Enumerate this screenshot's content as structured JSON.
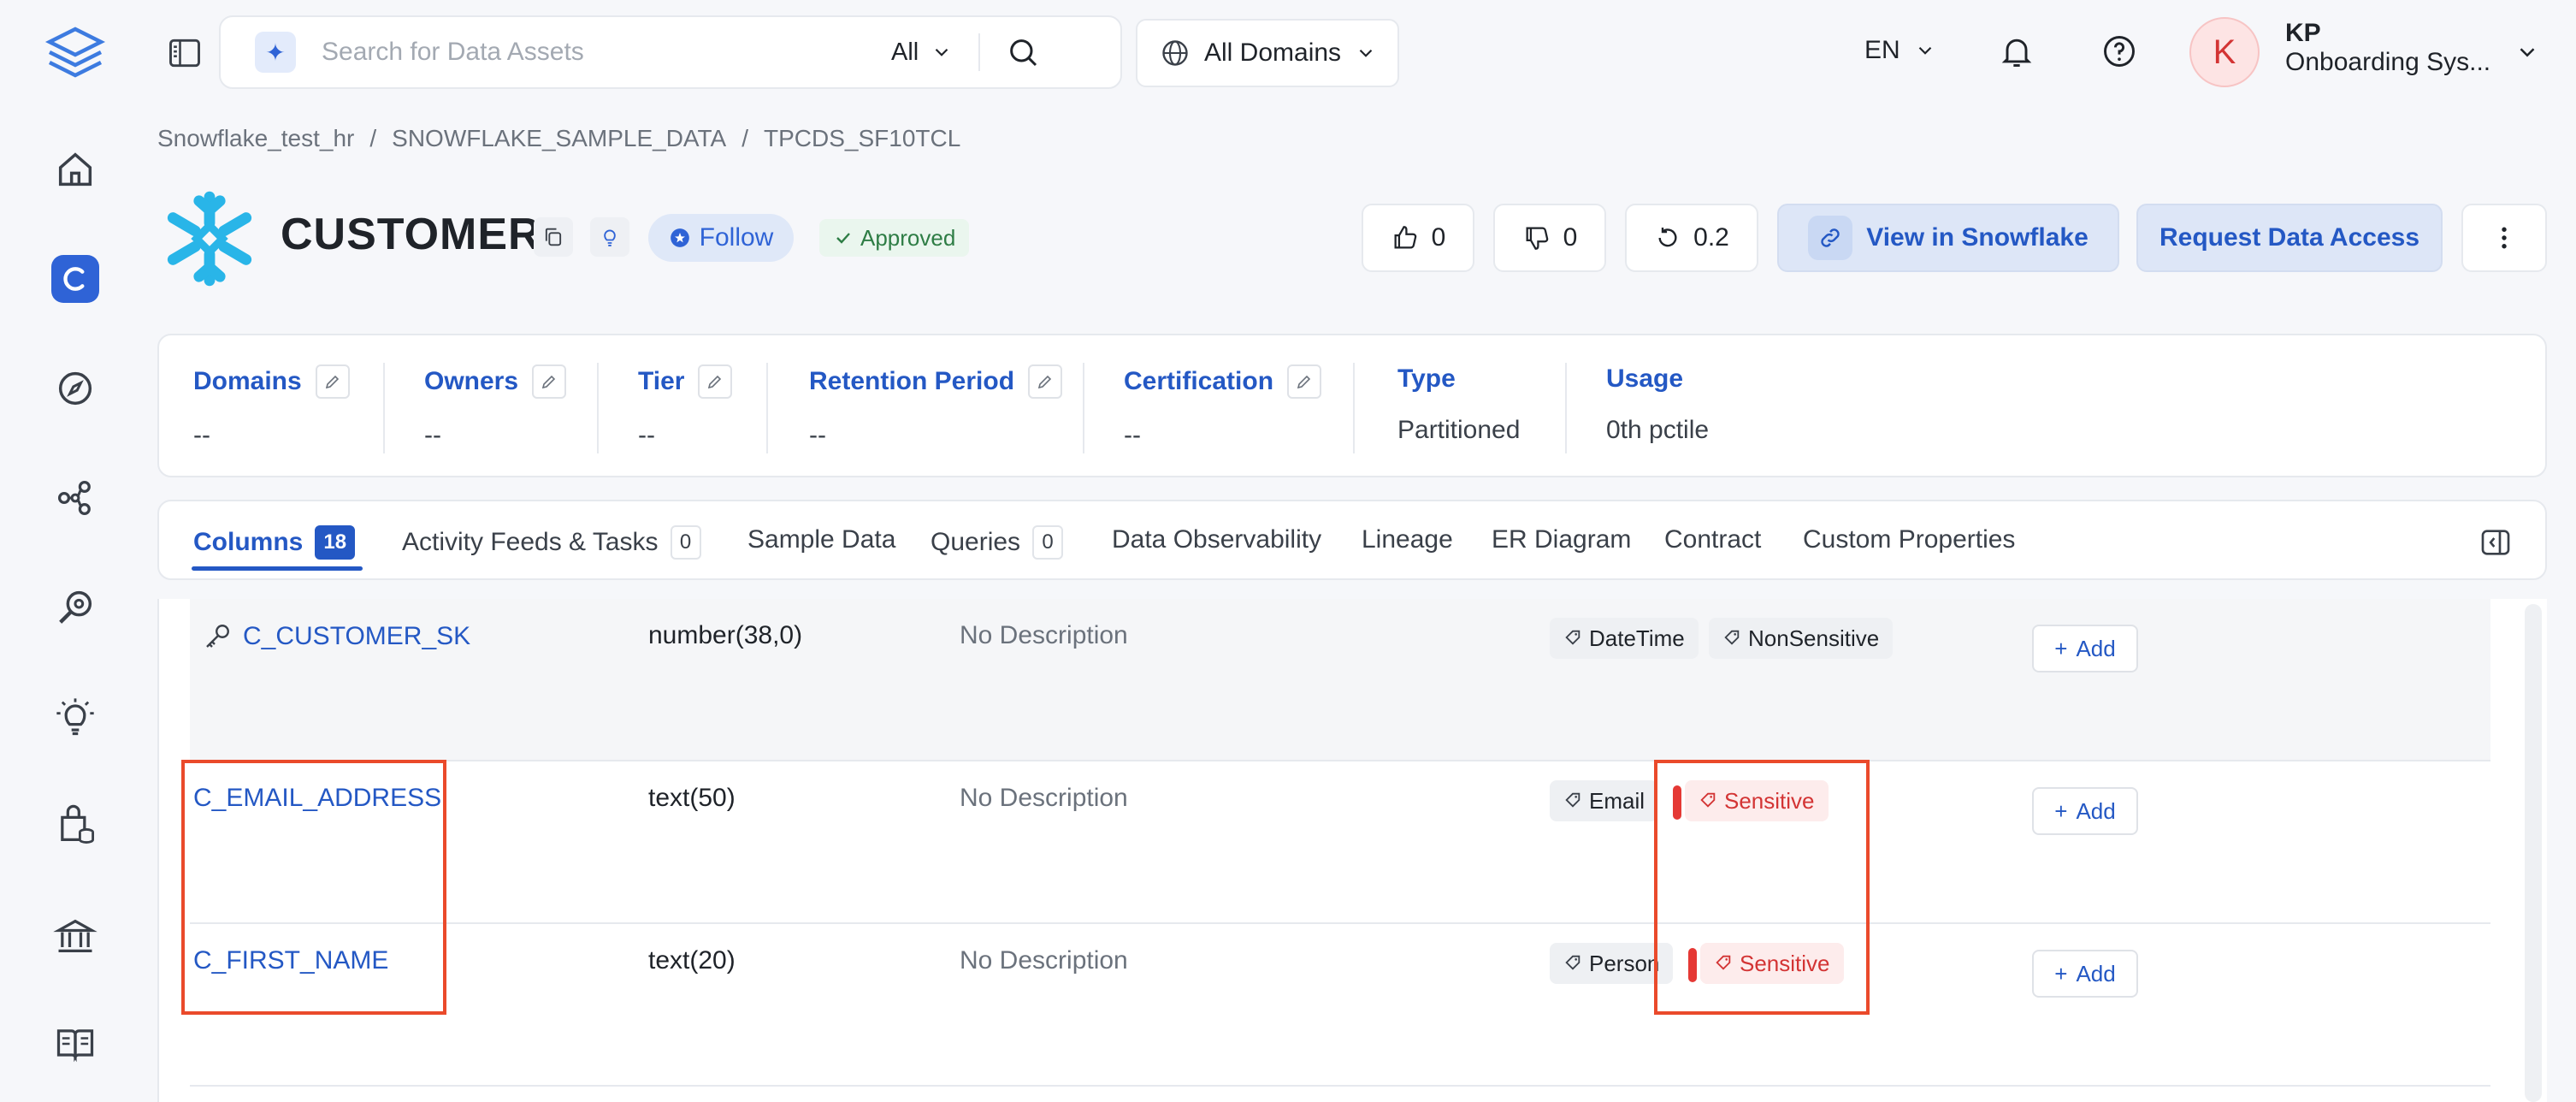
{
  "search": {
    "placeholder": "Search for Data Assets",
    "filter": "All"
  },
  "domains_button": "All Domains",
  "language": "EN",
  "user": {
    "initial": "K",
    "name": "KP",
    "team": "Onboarding Sys..."
  },
  "breadcrumb": [
    "Snowflake_test_hr",
    "/",
    "SNOWFLAKE_SAMPLE_DATA",
    "/",
    "TPCDS_SF10TCL"
  ],
  "entity": {
    "title": "CUSTOMER",
    "follow": "Follow",
    "status": "Approved"
  },
  "votes": {
    "up": "0",
    "down": "0",
    "version": "0.2"
  },
  "actions": {
    "view": "View in Snowflake",
    "request": "Request Data Access"
  },
  "properties": [
    {
      "label": "Domains",
      "value": "--"
    },
    {
      "label": "Owners",
      "value": "--"
    },
    {
      "label": "Tier",
      "value": "--"
    },
    {
      "label": "Retention Period",
      "value": "--"
    },
    {
      "label": "Certification",
      "value": "--"
    },
    {
      "label": "Type",
      "value": "Partitioned"
    },
    {
      "label": "Usage",
      "value": "0th pctile"
    }
  ],
  "tabs": [
    {
      "label": "Columns",
      "count": "18"
    },
    {
      "label": "Activity Feeds & Tasks",
      "count": "0"
    },
    {
      "label": "Sample Data"
    },
    {
      "label": "Queries",
      "count": "0"
    },
    {
      "label": "Data Observability"
    },
    {
      "label": "Lineage"
    },
    {
      "label": "ER Diagram"
    },
    {
      "label": "Contract"
    },
    {
      "label": "Custom Properties"
    }
  ],
  "columns": [
    {
      "name": "C_CUSTOMER_SK",
      "type": "number(38,0)",
      "description": "No Description",
      "tags": [
        "DateTime",
        "NonSensitive"
      ],
      "add": "Add"
    },
    {
      "name": "C_EMAIL_ADDRESS",
      "type": "text(50)",
      "description": "No Description",
      "tags": [
        "Email",
        "Sensitive"
      ],
      "add": "Add"
    },
    {
      "name": "C_FIRST_NAME",
      "type": "text(20)",
      "description": "No Description",
      "tags": [
        "Person",
        "Sensitive"
      ],
      "add": "Add"
    }
  ],
  "colors": {
    "accent": "#2458c4",
    "sensitive": "#d33434",
    "highlight": "#ea4a2b"
  }
}
